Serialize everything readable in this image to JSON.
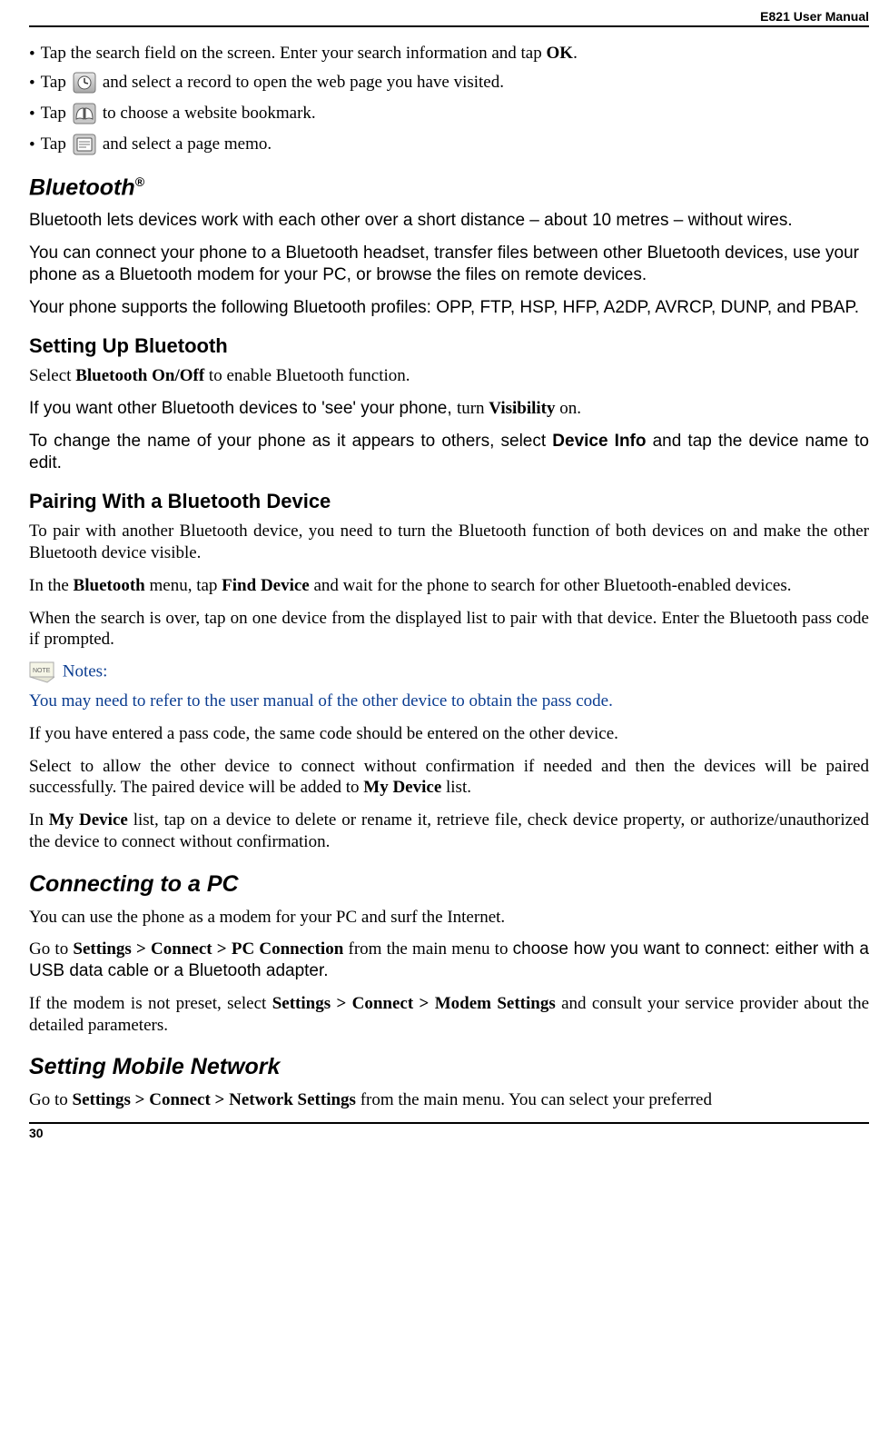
{
  "header": {
    "title": "E821 User Manual"
  },
  "footer": {
    "pageNumber": "30"
  },
  "bullets": {
    "b1": {
      "pre": "Tap the search field on the screen. Enter your search information and tap ",
      "bold": "OK",
      "post": "."
    },
    "b2": {
      "pre": "Tap ",
      "post": " and select a record to open the web page you have visited."
    },
    "b3": {
      "pre": "Tap ",
      "post": " to choose a website bookmark."
    },
    "b4": {
      "pre": "Tap ",
      "post": " and select a page memo."
    }
  },
  "bluetooth": {
    "title": "Bluetooth",
    "sup": "®",
    "p1": "Bluetooth lets devices work with each other over a short distance – about 10 metres – without wires.",
    "p2": "You can connect your phone to a Bluetooth headset, transfer files between other Bluetooth devices, use your phone as a Bluetooth modem for your PC, or browse the files on remote devices.",
    "p3": "Your phone supports the following Bluetooth profiles: OPP, FTP, HSP, HFP, A2DP, AVRCP, DUNP, and PBAP.",
    "setup": {
      "title": "Setting Up Bluetooth",
      "p1a": "Select ",
      "p1b": "Bluetooth On/Off",
      "p1c": " to enable Bluetooth function.",
      "p2a": "If you want other Bluetooth devices to 'see' your phone, ",
      "p2b": "turn ",
      "p2c": "Visibility",
      "p2d": " on.",
      "p3a": "To change the name of your phone as it appears to others, select ",
      "p3b": "Device Info",
      "p3c": " and tap the device name to edit."
    },
    "pairing": {
      "title": "Pairing With a Bluetooth Device",
      "p1": "To pair with another Bluetooth device, you need to turn the Bluetooth function of both devices on and make the other Bluetooth device visible.",
      "p2a": "In the ",
      "p2b": "Bluetooth",
      "p2c": " menu, tap ",
      "p2d": "Find Device",
      "p2e": " and wait for the phone to search for other Bluetooth-enabled devices.",
      "p3": "When the search is over, tap on one device from the displayed list to pair with that device. Enter the Bluetooth pass code if prompted.",
      "notesLabel": "Notes:",
      "n1": "You may need to refer to the user manual of the other device to obtain the pass code.",
      "n2": "If you have entered a pass code, the same code should be entered on the other device.",
      "n3a": "Select to allow the other device to connect without confirmation if needed and then the devices will be paired successfully. The paired device will be added to ",
      "n3b": "My Device",
      "n3c": " list.",
      "n4a": "In ",
      "n4b": "My Device",
      "n4c": " list, tap on a device to delete or rename it, retrieve file, check device property, or authorize/unauthorized the device to connect without confirmation."
    }
  },
  "pc": {
    "title": "Connecting to a PC",
    "p1": "You can use the phone as a modem for your PC and surf the Internet.",
    "p2a": "Go to ",
    "p2b": "Settings > Connect > PC Connection",
    "p2c": " from the main menu to ",
    "p2d": "choose how you want to connect: either with a USB data cable or a Bluetooth adapter.",
    "p3a": "If the modem is not preset, select ",
    "p3b": "Settings > Connect > Modem Settings",
    "p3c": " and consult your service provider about the detailed parameters."
  },
  "network": {
    "title": "Setting Mobile Network",
    "p1a": "Go to ",
    "p1b": "Settings > Connect > Network Settings",
    "p1c": " from the main menu. You can select your preferred"
  }
}
